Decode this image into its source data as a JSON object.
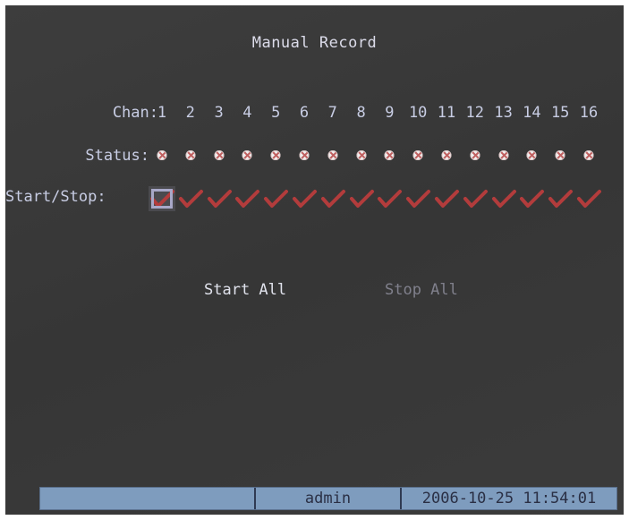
{
  "title": "Manual Record",
  "labels": {
    "chan": "Chan:",
    "status": "Status:",
    "start_stop": "Start/Stop:"
  },
  "channels": [
    "1",
    "2",
    "3",
    "4",
    "5",
    "6",
    "7",
    "8",
    "9",
    "10",
    "11",
    "12",
    "13",
    "14",
    "15",
    "16"
  ],
  "selected_channel_index": 0,
  "buttons": {
    "start_all": "Start All",
    "stop_all": "Stop All"
  },
  "statusbar": {
    "left": "",
    "user": "admin",
    "datetime": "2006-10-25 11:54:01"
  },
  "icons": {
    "status": "record-status-icon",
    "check": "checkmark-icon"
  },
  "colors": {
    "background": "#3a3a3a",
    "text": "#c8cde4",
    "check": "#b33c3c",
    "statusbar": "#7e9cbe",
    "disabled": "#80808c"
  }
}
